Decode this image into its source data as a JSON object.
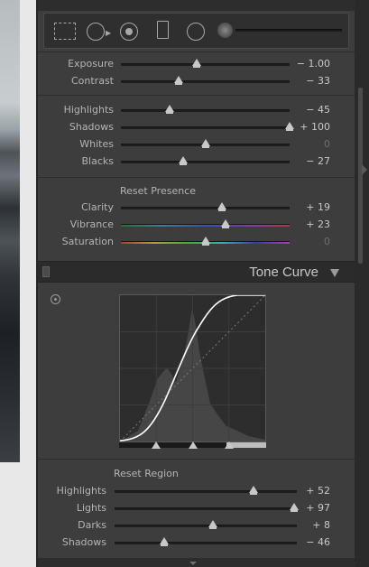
{
  "tools": [
    "crop-overlay-icon",
    "spot-removal-icon",
    "red-eye-icon",
    "graduated-filter-icon",
    "radial-filter-icon",
    "adjustment-brush-icon"
  ],
  "tone": [
    {
      "label": "Exposure",
      "value": "− 1.00",
      "pos": 0.45
    },
    {
      "label": "Contrast",
      "value": "− 33",
      "pos": 0.34
    }
  ],
  "range": [
    {
      "label": "Highlights",
      "value": "− 45",
      "pos": 0.29
    },
    {
      "label": "Shadows",
      "value": "+ 100",
      "pos": 1.0
    },
    {
      "label": "Whites",
      "value": "0",
      "pos": 0.5,
      "zero": true
    },
    {
      "label": "Blacks",
      "value": "− 27",
      "pos": 0.37
    }
  ],
  "presence": {
    "title": "Reset Presence",
    "items": [
      {
        "label": "Clarity",
        "value": "+ 19",
        "pos": 0.6
      },
      {
        "label": "Vibrance",
        "value": "+ 23",
        "pos": 0.62,
        "track": "vibrance"
      },
      {
        "label": "Saturation",
        "value": "0",
        "pos": 0.5,
        "zero": true,
        "track": "saturation"
      }
    ]
  },
  "tone_curve": {
    "title": "Tone Curve",
    "reset_label": "Reset Region",
    "region": [
      {
        "label": "Highlights",
        "value": "+ 52",
        "pos": 0.76
      },
      {
        "label": "Lights",
        "value": "+ 97",
        "pos": 0.985
      },
      {
        "label": "Darks",
        "value": "+ 8",
        "pos": 0.54
      },
      {
        "label": "Shadows",
        "value": "− 46",
        "pos": 0.27
      }
    ],
    "split_points": [
      0.25,
      0.5,
      0.75
    ]
  },
  "colors": {
    "panel": "#3d3d3d",
    "track": "#1e1e1e",
    "thumb": "#c8c8c8",
    "text": "#b4b4b4"
  }
}
